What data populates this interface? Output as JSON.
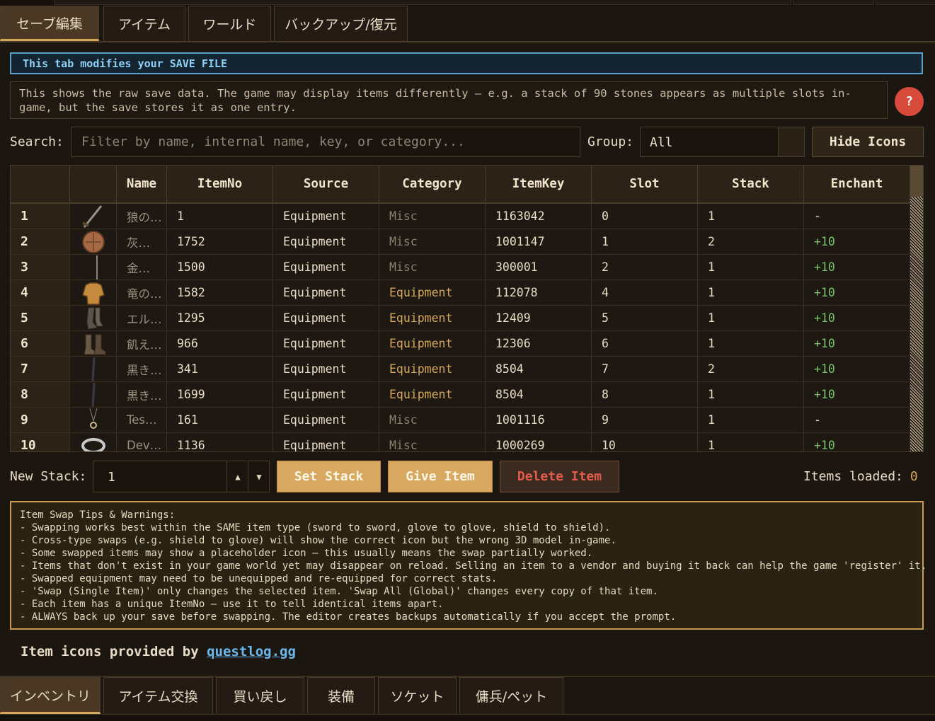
{
  "top_tabs": [
    "セーブ編集",
    "アイテム",
    "ワールド",
    "バックアップ/復元"
  ],
  "active_top_tab": 0,
  "banner": "This tab modifies your SAVE FILE",
  "info_text": "This shows the raw save data. The game may display items differently — e.g. a stack of 90 stones appears as multiple slots in-game, but the save stores it as one entry.",
  "help_label": "?",
  "search": {
    "label": "Search:",
    "placeholder": "Filter by name, internal name, key, or category...",
    "value": ""
  },
  "group": {
    "label": "Group:",
    "value": "All"
  },
  "hide_icons_label": "Hide Icons",
  "columns": [
    "",
    "",
    "Name",
    "ItemNo",
    "Source",
    "Category",
    "ItemKey",
    "Slot",
    "Stack",
    "Enchant"
  ],
  "rows": [
    {
      "idx": "1",
      "icon": "sword-icon",
      "name": "狼の…",
      "itemno": "1",
      "source": "Equipment",
      "category": "Misc",
      "itemkey": "1163042",
      "slot": "0",
      "stack": "1",
      "enchant": "-"
    },
    {
      "idx": "2",
      "icon": "shield-icon",
      "name": "灰…",
      "itemno": "1752",
      "source": "Equipment",
      "category": "Misc",
      "itemkey": "1001147",
      "slot": "1",
      "stack": "2",
      "enchant": "+10"
    },
    {
      "idx": "3",
      "icon": "staff-icon",
      "name": "金…",
      "itemno": "1500",
      "source": "Equipment",
      "category": "Misc",
      "itemkey": "300001",
      "slot": "2",
      "stack": "1",
      "enchant": "+10"
    },
    {
      "idx": "4",
      "icon": "armor-icon",
      "name": "竜の…",
      "itemno": "1582",
      "source": "Equipment",
      "category": "Equipment",
      "itemkey": "112078",
      "slot": "4",
      "stack": "1",
      "enchant": "+10"
    },
    {
      "idx": "5",
      "icon": "greaves-icon",
      "name": "エル…",
      "itemno": "1295",
      "source": "Equipment",
      "category": "Equipment",
      "itemkey": "12409",
      "slot": "5",
      "stack": "1",
      "enchant": "+10"
    },
    {
      "idx": "6",
      "icon": "boots-icon",
      "name": "飢え…",
      "itemno": "966",
      "source": "Equipment",
      "category": "Equipment",
      "itemkey": "12306",
      "slot": "6",
      "stack": "1",
      "enchant": "+10"
    },
    {
      "idx": "7",
      "icon": "dark-blade-icon",
      "name": "黒き…",
      "itemno": "341",
      "source": "Equipment",
      "category": "Equipment",
      "itemkey": "8504",
      "slot": "7",
      "stack": "2",
      "enchant": "+10"
    },
    {
      "idx": "8",
      "icon": "dark-blade-icon",
      "name": "黒き…",
      "itemno": "1699",
      "source": "Equipment",
      "category": "Equipment",
      "itemkey": "8504",
      "slot": "8",
      "stack": "1",
      "enchant": "+10"
    },
    {
      "idx": "9",
      "icon": "necklace-icon",
      "name": "Tes…",
      "itemno": "161",
      "source": "Equipment",
      "category": "Misc",
      "itemkey": "1001116",
      "slot": "9",
      "stack": "1",
      "enchant": "-"
    },
    {
      "idx": "10",
      "icon": "ring-icon",
      "name": "Dev…",
      "itemno": "1136",
      "source": "Equipment",
      "category": "Misc",
      "itemkey": "1000269",
      "slot": "10",
      "stack": "1",
      "enchant": "+10"
    }
  ],
  "new_stack": {
    "label": "New Stack:",
    "value": "1"
  },
  "buttons": {
    "set_stack": "Set Stack",
    "give_item": "Give Item",
    "delete_item": "Delete Item"
  },
  "items_loaded": {
    "label": "Items loaded:",
    "value": "0"
  },
  "tips": [
    "Item Swap Tips & Warnings:",
    "- Swapping works best within the SAME item type (sword to sword, glove to glove, shield to shield).",
    "- Cross-type swaps (e.g. shield to glove) will show the correct icon but the wrong 3D model in-game.",
    "- Some swapped items may show a placeholder icon — this usually means the swap partially worked.",
    "- Items that don't exist in your game world yet may disappear on reload. Selling an item to a vendor and buying it back can help the game 'register' it.",
    "- Swapped equipment may need to be unequipped and re-equipped for correct stats.",
    "- 'Swap (Single Item)' only changes the selected item. 'Swap All (Global)' changes every copy of that item.",
    "- Each item has a unique ItemNo — use it to tell identical items apart.",
    "- ALWAYS back up your save before swapping. The editor creates backups automatically if you accept the prompt."
  ],
  "credit": {
    "prefix": "Item icons provided by ",
    "link": "questlog.gg"
  },
  "bottom_tabs": [
    "インベントリ",
    "アイテム交換",
    "買い戻し",
    "装備",
    "ソケット",
    "傭兵/ペット"
  ],
  "active_bottom_tab": 0
}
